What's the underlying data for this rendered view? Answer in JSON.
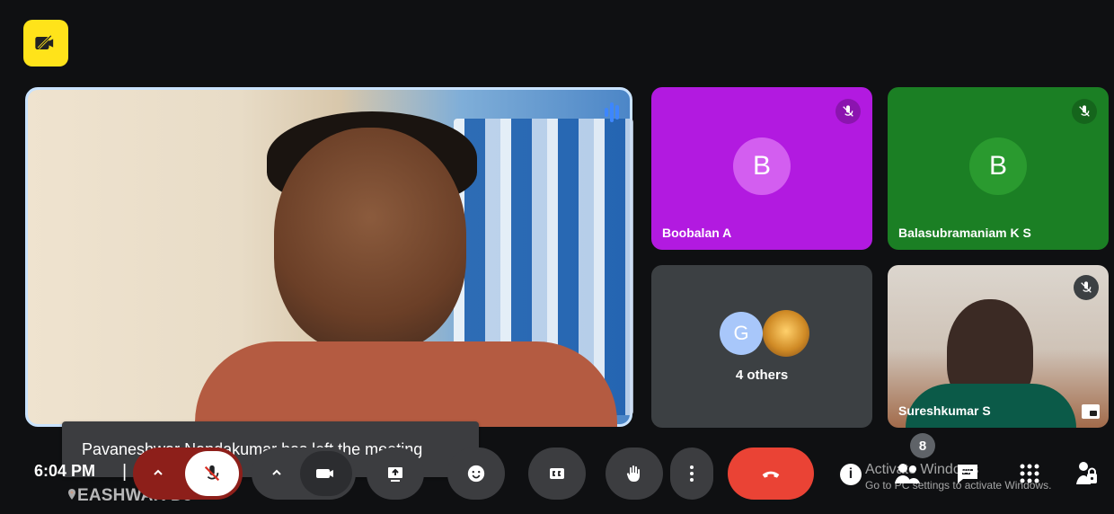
{
  "topbar": {
    "badge_icon": "camera-off-icon"
  },
  "main_stage": {
    "toast": "Pavaneshwar Nandakumar has left the meeting",
    "speaker_name": "EASHWAR DJ",
    "speaking_icon": "speaking-bars-icon",
    "pin_icon": "pin-icon"
  },
  "participants": {
    "tile1": {
      "name": "Boobalan A",
      "initial": "B",
      "muted_icon": "mic-off-icon"
    },
    "tile2": {
      "name": "Balasubramaniam K S",
      "initial": "B",
      "muted_icon": "mic-off-icon"
    },
    "others": {
      "label": "4 others",
      "avatar_initial": "G"
    },
    "tile4": {
      "name": "Sureshkumar S",
      "muted_icon": "mic-off-icon",
      "pip_icon": "picture-in-picture-icon"
    }
  },
  "toolbar": {
    "time": "6:04 PM",
    "separator": "|",
    "participant_count": "8",
    "watermark_title": "Activate Windows",
    "watermark_subtitle": "Go to PC settings to activate Windows."
  },
  "colors": {
    "yellow": "#ffe31a",
    "magenta": "#b21ae0",
    "green": "#1b7f24",
    "red": "#ea4335",
    "toolbar": "#3c3d40"
  }
}
